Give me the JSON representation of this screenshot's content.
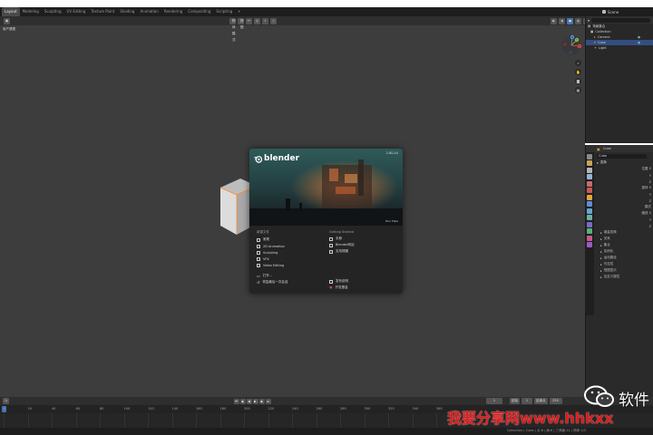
{
  "menubar": {
    "workspace_tabs": [
      "Layout",
      "Modeling",
      "Sculpting",
      "UV Editing",
      "Texture Paint",
      "Shading",
      "Animation",
      "Rendering",
      "Compositing",
      "Scripting",
      "+"
    ],
    "scene_label": "Scene"
  },
  "viewport": {
    "header": {
      "mode_label": "物体模式",
      "view_label": "视图"
    },
    "perspective_label": "用户透视",
    "gizmo": {
      "x": "X",
      "y": "Y",
      "z": "Z"
    }
  },
  "outliner": {
    "title": "场景集合",
    "items": [
      {
        "label": "Collection"
      },
      {
        "label": "Camera"
      },
      {
        "label": "Cube"
      },
      {
        "label": "Light"
      }
    ]
  },
  "properties": {
    "object_name": "Cube",
    "subname": "Cube",
    "section_transform": "变换",
    "rows": [
      "位置 X",
      "Y",
      "Z",
      "旋转 X",
      "Y",
      "Z",
      "模式",
      "缩放 X",
      "Y",
      "Z"
    ],
    "sections": [
      "增量变换",
      "关系",
      "集合",
      "实例化",
      "运动路径",
      "可见性",
      "视图显示",
      "自定义属性"
    ]
  },
  "splash": {
    "brand": "blender",
    "version": "2.80.44",
    "credit": "Hiro Flats",
    "new_file_title": "新建文件",
    "new_items": [
      "常规",
      "2D Animation",
      "Sculpting",
      "VFX",
      "Video Editing"
    ],
    "open_label": "打开...",
    "recover_label": "恢复最后一次会话",
    "getting_started_title": "Getting Started",
    "gs_items": [
      "手册",
      "Blender网站",
      "支持捐赠"
    ],
    "release_notes": "发布说明",
    "dev_fund": "开发基金"
  },
  "timeline": {
    "ticks": [
      "0",
      "20",
      "40",
      "60",
      "80",
      "100",
      "120",
      "140",
      "160",
      "180",
      "200",
      "220",
      "240",
      "260",
      "280",
      "300",
      "320",
      "340",
      "360"
    ],
    "frame_start_label": "起始",
    "frame_start": "1",
    "frame_end_label": "结束点",
    "frame_end": "250",
    "current_frame": "1"
  },
  "statusbar": {
    "info": "Collection | Cube | 点:8 | 面:6 | 三角面:12 | 物体:1/3"
  },
  "watermark": {
    "text": "我要分享网www.hhkxx",
    "logo_text": "软件"
  },
  "colors": {
    "accent": "#4772b3",
    "viewport_bg": "#3d3d3d",
    "watermark_red": "#e0191a"
  }
}
